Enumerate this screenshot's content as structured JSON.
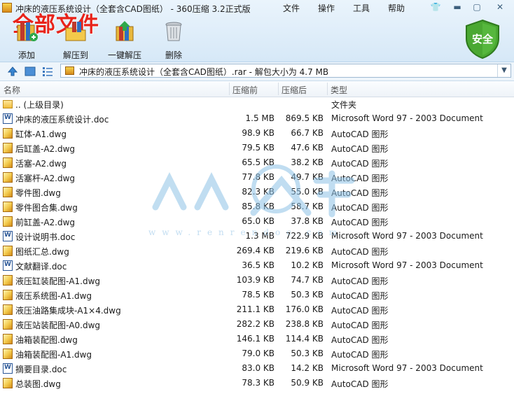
{
  "window": {
    "title": "冲床的液压系统设计（全套含CAD图纸） - 360压缩 3.2正式版",
    "overlay_text": "全部文件",
    "menu": [
      "文件",
      "操作",
      "工具",
      "帮助"
    ]
  },
  "toolbar": {
    "add": "添加",
    "extract_to": "解压到",
    "one_click_extract": "一键解压",
    "delete": "删除",
    "security": "安全"
  },
  "address": {
    "path": "冲床的液压系统设计（全套含CAD图纸）.rar - 解包大小为 4.7 MB"
  },
  "columns": {
    "name": "名称",
    "size": "压缩前",
    "packed": "压缩后",
    "type": "类型"
  },
  "files": [
    {
      "name": ".. (上级目录)",
      "size": "",
      "packed": "",
      "type": "文件夹",
      "icon": "folder-icon"
    },
    {
      "name": "冲床的液压系统设计.doc",
      "size": "1.5 MB",
      "packed": "869.5 KB",
      "type": "Microsoft Word 97 - 2003 Document",
      "icon": "doc-icon"
    },
    {
      "name": "缸体-A1.dwg",
      "size": "98.9 KB",
      "packed": "66.7 KB",
      "type": "AutoCAD 图形",
      "icon": "dwg-icon"
    },
    {
      "name": "后缸盖-A2.dwg",
      "size": "79.5 KB",
      "packed": "47.6 KB",
      "type": "AutoCAD 图形",
      "icon": "dwg-icon"
    },
    {
      "name": "活塞-A2.dwg",
      "size": "65.5 KB",
      "packed": "38.2 KB",
      "type": "AutoCAD 图形",
      "icon": "dwg-icon"
    },
    {
      "name": "活塞杆-A2.dwg",
      "size": "77.8 KB",
      "packed": "49.7 KB",
      "type": "AutoCAD 图形",
      "icon": "dwg-icon"
    },
    {
      "name": "零件图.dwg",
      "size": "82.3 KB",
      "packed": "55.0 KB",
      "type": "AutoCAD 图形",
      "icon": "dwg-icon"
    },
    {
      "name": "零件图合集.dwg",
      "size": "85.8 KB",
      "packed": "58.7 KB",
      "type": "AutoCAD 图形",
      "icon": "dwg-icon"
    },
    {
      "name": "前缸盖-A2.dwg",
      "size": "65.0 KB",
      "packed": "37.8 KB",
      "type": "AutoCAD 图形",
      "icon": "dwg-icon"
    },
    {
      "name": "设计说明书.doc",
      "size": "1.3 MB",
      "packed": "722.9 KB",
      "type": "Microsoft Word 97 - 2003 Document",
      "icon": "doc-icon"
    },
    {
      "name": "图纸汇总.dwg",
      "size": "269.4 KB",
      "packed": "219.6 KB",
      "type": "AutoCAD 图形",
      "icon": "dwg-icon"
    },
    {
      "name": "文献翻译.doc",
      "size": "36.5 KB",
      "packed": "10.2 KB",
      "type": "Microsoft Word 97 - 2003 Document",
      "icon": "doc-icon"
    },
    {
      "name": "液压缸装配图-A1.dwg",
      "size": "103.9 KB",
      "packed": "74.7 KB",
      "type": "AutoCAD 图形",
      "icon": "dwg-icon"
    },
    {
      "name": "液压系统图-A1.dwg",
      "size": "78.5 KB",
      "packed": "50.3 KB",
      "type": "AutoCAD 图形",
      "icon": "dwg-icon"
    },
    {
      "name": "液压油路集成块-A1×4.dwg",
      "size": "211.1 KB",
      "packed": "176.0 KB",
      "type": "AutoCAD 图形",
      "icon": "dwg-icon"
    },
    {
      "name": "液压站装配图-A0.dwg",
      "size": "282.2 KB",
      "packed": "238.8 KB",
      "type": "AutoCAD 图形",
      "icon": "dwg-icon"
    },
    {
      "name": "油箱装配图.dwg",
      "size": "146.1 KB",
      "packed": "114.4 KB",
      "type": "AutoCAD 图形",
      "icon": "dwg-icon"
    },
    {
      "name": "油箱装配图-A1.dwg",
      "size": "79.0 KB",
      "packed": "50.3 KB",
      "type": "AutoCAD 图形",
      "icon": "dwg-icon"
    },
    {
      "name": "摘要目录.doc",
      "size": "83.0 KB",
      "packed": "14.2 KB",
      "type": "Microsoft Word 97 - 2003 Document",
      "icon": "doc-icon"
    },
    {
      "name": "总装图.dwg",
      "size": "78.3 KB",
      "packed": "50.9 KB",
      "type": "AutoCAD 图形",
      "icon": "dwg-icon"
    }
  ]
}
